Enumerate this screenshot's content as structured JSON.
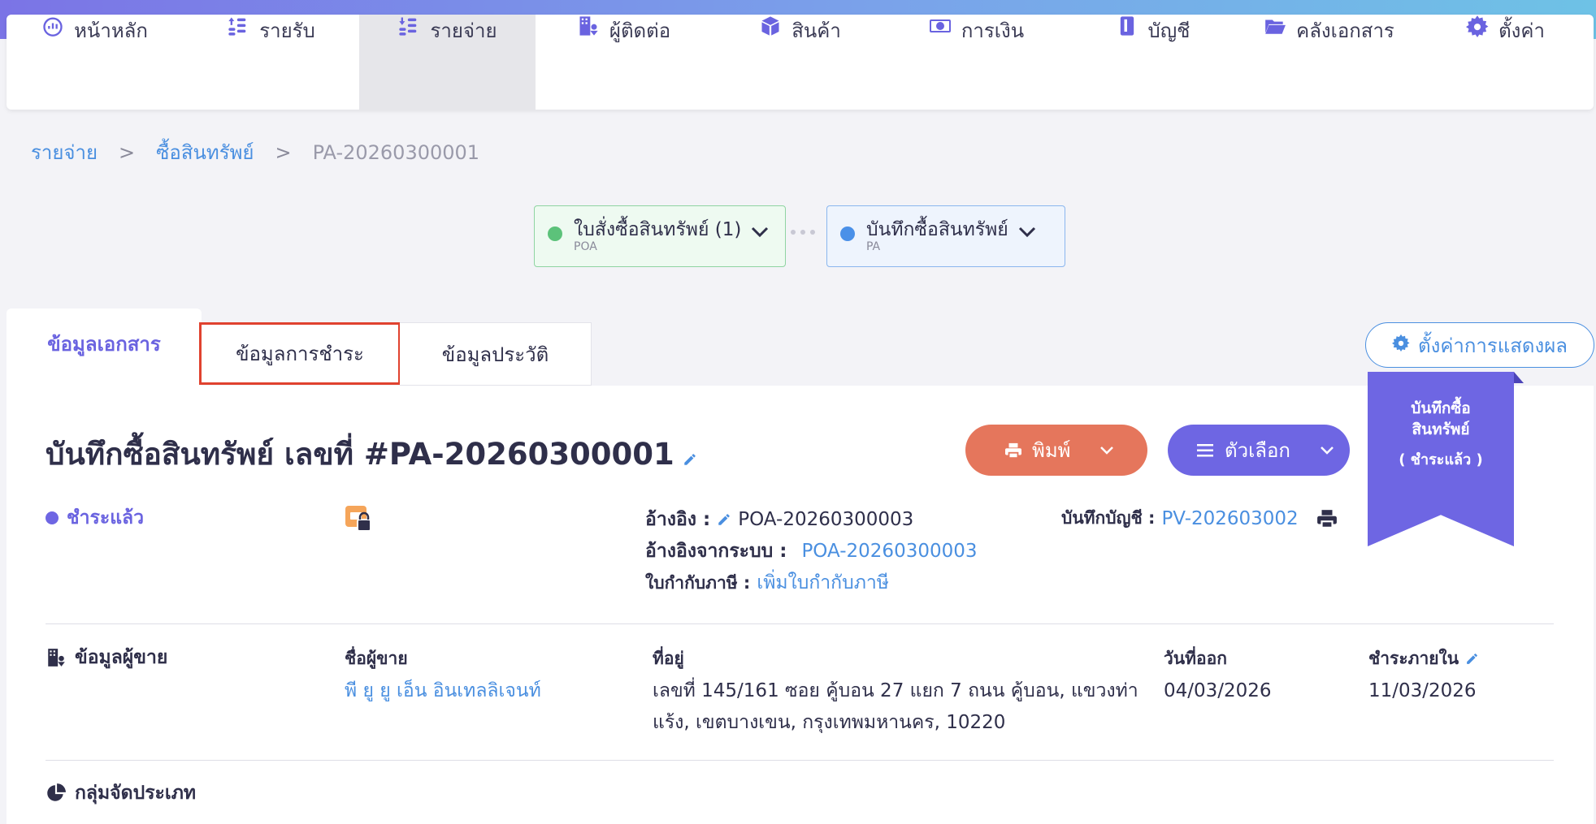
{
  "nav": {
    "items": [
      {
        "label": "หน้าหลัก",
        "icon": "dashboard-icon"
      },
      {
        "label": "รายรับ",
        "icon": "income-icon"
      },
      {
        "label": "รายจ่าย",
        "icon": "expense-icon"
      },
      {
        "label": "ผู้ติดต่อ",
        "icon": "contacts-icon"
      },
      {
        "label": "สินค้า",
        "icon": "product-box-icon"
      },
      {
        "label": "การเงิน",
        "icon": "money-icon"
      },
      {
        "label": "บัญชี",
        "icon": "ledger-icon"
      },
      {
        "label": "คลังเอกสาร",
        "icon": "folder-icon"
      },
      {
        "label": "ตั้งค่า",
        "icon": "gear-icon"
      }
    ],
    "active_index": 2
  },
  "breadcrumb": {
    "level1": "รายจ่าย",
    "level2": "ซื้อสินทรัพย์",
    "current": "PA-20260300001",
    "separator": ">"
  },
  "flow": {
    "step1": {
      "label": "ใบสั่งซื้อสินทรัพย์ (1)",
      "sub": "POA",
      "dot_color": "#5cc27a"
    },
    "step2": {
      "label": "บันทึกซื้อสินทรัพย์",
      "sub": "PA",
      "dot_color": "#4a90e8"
    }
  },
  "tabs": {
    "document_info": "ข้อมูลเอกสาร",
    "payment_info": "ข้อมูลการชำระ",
    "history_info": "ข้อมูลประวัติ"
  },
  "display_settings_label": "ตั้งค่าการแสดงผล",
  "document": {
    "title": "บันทึกซื้อสินทรัพย์ เลขที่ #PA-20260300001",
    "status": "ชำระแล้ว",
    "print_label": "พิมพ์",
    "options_label": "ตัวเลือก",
    "ribbon_line1": "บันทึกซื้อ",
    "ribbon_line2": "สินทรัพย์",
    "ribbon_line3": "( ชำระแล้ว )",
    "reference_label": "อ้างอิง :",
    "reference_value": "POA-20260300003",
    "system_ref_label": "อ้างอิงจากระบบ :",
    "system_ref_value": "POA-20260300003",
    "tax_invoice_label": "ใบกำกับภาษี :",
    "tax_invoice_link": "เพิ่มใบกำกับภาษี",
    "journal_label": "บันทึกบัญชี :",
    "journal_value": "PV-202603002"
  },
  "vendor": {
    "section_title": "ข้อมูลผู้ขาย",
    "name_label": "ชื่อผู้ขาย",
    "name_value": "พี ยู ยู เอ็น อินเทลลิเจนท์",
    "address_label": "ที่อยู่",
    "address_line1": "เลขที่ 145/161 ซอย คู้บอน 27 แยก 7 ถนน คู้บอน, แขวงท่า",
    "address_line2": "แร้ง, เขตบางเขน, กรุงเทพมหานคร, 10220",
    "issue_date_label": "วันที่ออก",
    "issue_date_value": "04/03/2026",
    "due_label": "ชำระภายใน",
    "due_value": "11/03/2026"
  },
  "category": {
    "section_title": "กลุ่มจัดประเภท"
  }
}
